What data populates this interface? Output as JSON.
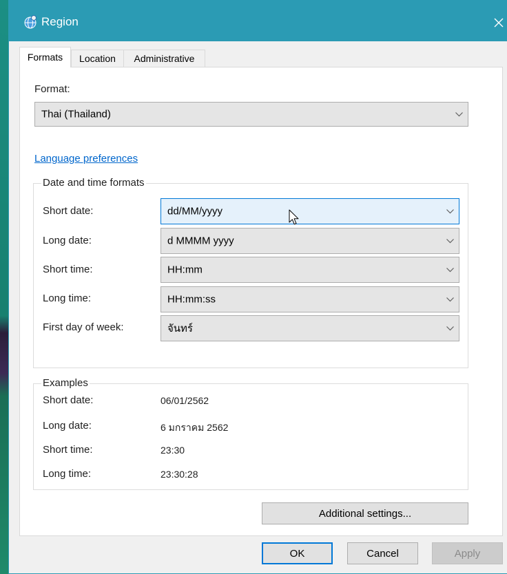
{
  "window": {
    "title": "Region"
  },
  "tabs": [
    {
      "label": "Formats",
      "selected": true
    },
    {
      "label": "Location",
      "selected": false
    },
    {
      "label": "Administrative",
      "selected": false
    }
  ],
  "format": {
    "label": "Format:",
    "value": "Thai (Thailand)"
  },
  "language_preferences_link": "Language preferences",
  "date_time_formats": {
    "legend": "Date and time formats",
    "rows": [
      {
        "label": "Short date:",
        "value": "dd/MM/yyyy",
        "hovered": true
      },
      {
        "label": "Long date:",
        "value": "d MMMM yyyy"
      },
      {
        "label": "Short time:",
        "value": "HH:mm"
      },
      {
        "label": "Long time:",
        "value": "HH:mm:ss"
      },
      {
        "label": "First day of week:",
        "value": "จันทร์"
      }
    ]
  },
  "examples": {
    "legend": "Examples",
    "rows": [
      {
        "label": "Short date:",
        "value": "06/01/2562"
      },
      {
        "label": "Long date:",
        "value": "6 มกราคม 2562"
      },
      {
        "label": "Short time:",
        "value": "23:30"
      },
      {
        "label": "Long time:",
        "value": "23:30:28"
      }
    ]
  },
  "additional_settings_button": "Additional settings...",
  "buttons": {
    "ok": "OK",
    "cancel": "Cancel",
    "apply": "Apply",
    "apply_disabled": true
  },
  "colors": {
    "title_bar": "#2b9bb4",
    "link": "#0066cc",
    "focus_border": "#0078d7",
    "hover_fill": "#e5f1fb"
  },
  "icons": {
    "app": "region-globe-icon",
    "close": "close-icon",
    "dropdown": "chevron-down-icon",
    "pointer": "mouse-cursor-icon"
  }
}
